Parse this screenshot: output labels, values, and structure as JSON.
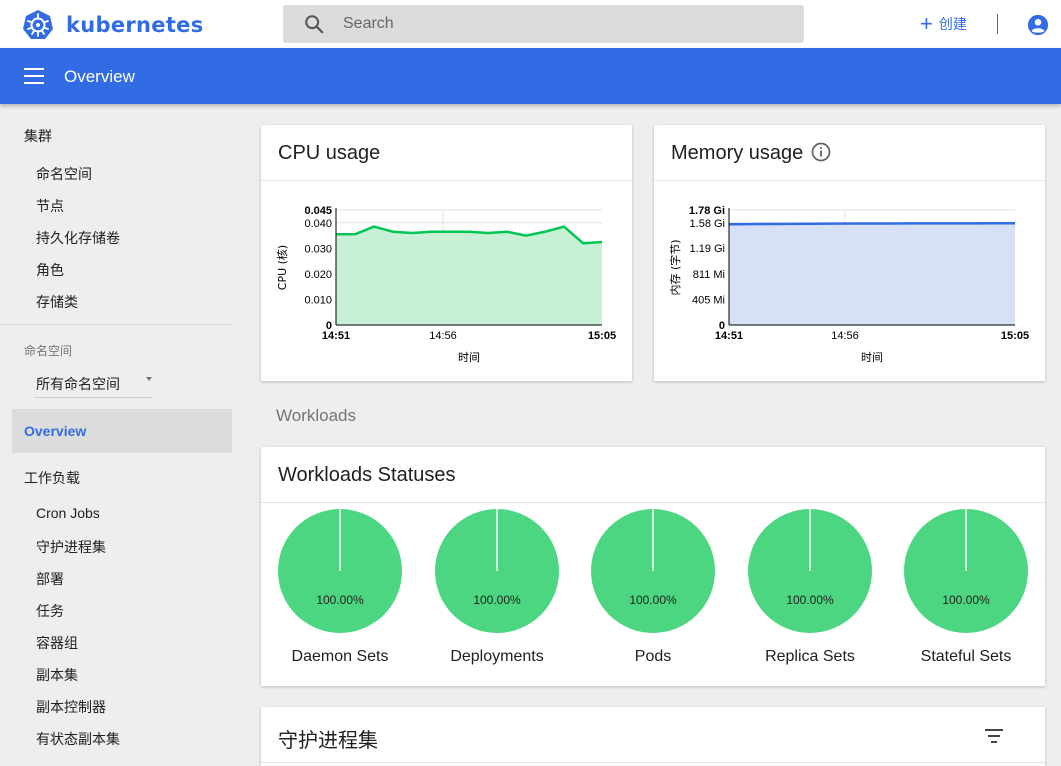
{
  "topbar": {
    "brand": "kubernetes",
    "search_placeholder": "Search",
    "create_label": "创建",
    "icons": {
      "logo": "kubernetes-logo",
      "search": "search-icon",
      "create": "plus-icon",
      "account": "account-circle-icon"
    }
  },
  "header": {
    "title": "Overview",
    "menu_icon": "menu-icon"
  },
  "sidebar": {
    "cluster_label": "集群",
    "cluster_items": [
      "命名空间",
      "节点",
      "持久化存储卷",
      "角色",
      "存储类"
    ],
    "namespace_label": "命名空间",
    "namespace_value": "所有命名空间",
    "active_item": "Overview",
    "workloads_label": "工作负载",
    "workload_items": [
      "Cron Jobs",
      "守护进程集",
      "部署",
      "任务",
      "容器组",
      "副本集",
      "副本控制器",
      "有状态副本集"
    ]
  },
  "cpu_card": {
    "title": "CPU usage",
    "ylabel": "CPU (核)",
    "xlabel": "时间",
    "y_ticks": [
      "0.045",
      "0.040",
      "0.030",
      "0.020",
      "0.010",
      "0"
    ],
    "x_ticks": [
      "14:51",
      "14:56",
      "15:05"
    ],
    "line_color": "#00c752",
    "fill_color": "#c8f0d6"
  },
  "memory_card": {
    "title": "Memory usage",
    "info_icon": "info-icon",
    "ylabel": "内存 (字节)",
    "xlabel": "时间",
    "y_ticks": [
      "1.78 Gi",
      "1.58 Gi",
      "1.19 Gi",
      "811 Mi",
      "405 Mi",
      "0"
    ],
    "x_ticks": [
      "14:51",
      "14:56",
      "15:05"
    ],
    "line_color": "#326ce5",
    "fill_color": "#d6e0f7"
  },
  "chart_data": [
    {
      "type": "area",
      "title": "CPU usage",
      "xlabel": "时间",
      "ylabel": "CPU (核)",
      "x": [
        "14:51",
        "14:52",
        "14:53",
        "14:54",
        "14:55",
        "14:56",
        "14:57",
        "14:58",
        "14:59",
        "15:00",
        "15:01",
        "15:02",
        "15:03",
        "15:04",
        "15:05"
      ],
      "series": [
        {
          "values": [
            0.0355,
            0.0355,
            0.0385,
            0.0365,
            0.036,
            0.0365,
            0.0365,
            0.0365,
            0.036,
            0.0365,
            0.035,
            0.0365,
            0.0385,
            0.032,
            0.0325
          ]
        }
      ],
      "ylim": [
        0,
        0.045
      ],
      "grid": true
    },
    {
      "type": "area",
      "title": "Memory usage",
      "xlabel": "时间",
      "ylabel": "内存 (字节)",
      "x": [
        "14:51",
        "14:56",
        "15:05"
      ],
      "series": [
        {
          "values": [
            1.56,
            1.57,
            1.575
          ]
        }
      ],
      "y_unit": "Gi",
      "ylim": [
        0,
        1.78
      ],
      "grid": true
    },
    {
      "type": "pie",
      "title": "Workloads Statuses",
      "charts": [
        {
          "name": "Daemon Sets",
          "running_percent": 100.0,
          "label": "100.00%"
        },
        {
          "name": "Deployments",
          "running_percent": 100.0,
          "label": "100.00%"
        },
        {
          "name": "Pods",
          "running_percent": 100.0,
          "label": "100.00%"
        },
        {
          "name": "Replica Sets",
          "running_percent": 100.0,
          "label": "100.00%"
        },
        {
          "name": "Stateful Sets",
          "running_percent": 100.0,
          "label": "100.00%"
        }
      ],
      "color": "#4cd681"
    }
  ],
  "workloads_section_label": "Workloads",
  "statuses_card": {
    "title": "Workloads Statuses"
  },
  "daemonsets_card": {
    "title": "守护进程集",
    "filter_icon": "filter-icon"
  }
}
